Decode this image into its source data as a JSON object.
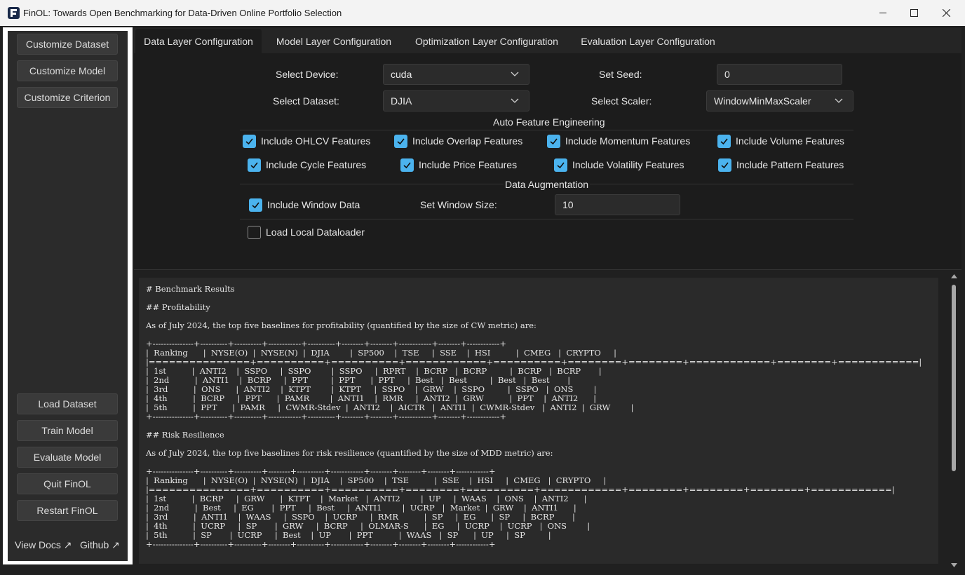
{
  "window": {
    "title": "FinOL: Towards Open Benchmarking for Data-Driven Online Portfolio Selection",
    "icons": {
      "app": "finol-logo-icon",
      "minimize": "minimize-icon",
      "maximize": "maximize-icon",
      "close": "close-icon"
    }
  },
  "sidebar": {
    "top_buttons": [
      "Customize Dataset",
      "Customize Model",
      "Customize Criterion"
    ],
    "bottom_buttons": [
      "Load Dataset",
      "Train Model",
      "Evaluate Model",
      "Quit FinOL",
      "Restart FinOL"
    ],
    "links": [
      "View Docs ↗",
      "Github ↗"
    ]
  },
  "tabs": [
    "Data Layer Configuration",
    "Model Layer Configuration",
    "Optimization Layer Configuration",
    "Evaluation Layer Configuration"
  ],
  "config": {
    "device": {
      "label": "Select Device:",
      "value": "cuda"
    },
    "seed": {
      "label": "Set Seed:",
      "value": "0"
    },
    "dataset": {
      "label": "Select Dataset:",
      "value": "DJIA"
    },
    "scaler": {
      "label": "Select Scaler:",
      "value": "WindowMinMaxScaler"
    },
    "feature_section": "Auto Feature Engineering",
    "features": [
      {
        "label": "Include OHLCV Features",
        "checked": true
      },
      {
        "label": "Include Overlap Features",
        "checked": true
      },
      {
        "label": "Include Momentum Features",
        "checked": true
      },
      {
        "label": "Include Volume Features",
        "checked": true
      },
      {
        "label": "Include Cycle Features",
        "checked": true
      },
      {
        "label": "Include Price Features",
        "checked": true
      },
      {
        "label": "Include Volatility Features",
        "checked": true
      },
      {
        "label": "Include Pattern Features",
        "checked": true
      }
    ],
    "augmentation_section": "Data Augmentation",
    "window_data": {
      "label": "Include Window Data",
      "checked": true
    },
    "window_size": {
      "label": "Set Window Size:",
      "value": "10"
    },
    "local_loader": {
      "label": "Load Local Dataloader",
      "checked": false
    }
  },
  "results": {
    "heading": "# Benchmark Results",
    "profit_heading": "## Profitability",
    "profit_intro": "As of July 2024, the top five baselines for profitability (quantified by the size of CW metric) are:",
    "profit_table": "+---------------+----------+----------+------------+----------+--------+--------+------------+--------+------------+\n|  Ranking      |  NYSE(O)  |  NYSE(N)  |  DJIA        |  SP500    |  TSE     |  SSE    |  HSI          |  CMEG   |  CRYPTO     |\n|===============+==========+==========+============+==========+========+========+============+========+============|\n|  1st          |  ANTI2    |  SSPO     |  SSPO        |  SSPO     |  RPRT    |  BCRP   |  BCRP         |  BCRP   |  BCRP       |\n|  2nd          |  ANTI1    |  BCRP     |  PPT         |  PPT      |  PPT     |  Best   |  Best         |  Best   |  Best       |\n|  3rd          |  ONS      |  ANTI2    |  KTPT        |  KTPT     |  SSPO    |  GRW    |  SSPO         |  SSPO   |  ONS        |\n|  4th          |  BCRP     |  PPT      |  PAMR        |  ANTI1    |  RMR     |  ANTI2  |  GRW          |  PPT    |  ANTI2      |\n|  5th          |  PPT      |  PAMR     |  CWMR-Stdev  |  ANTI2    |  AICTR   |  ANTI1  |  CWMR-Stdev   |  ANTI2  |  GRW        |\n+---------------+----------+----------+------------+----------+--------+--------+------------+--------+------------+",
    "risk_heading": "## Risk Resilience",
    "risk_intro": "As of July 2024, the top five baselines for risk resilience (quantified by the size of MDD metric) are:",
    "risk_table": "+---------------+----------+----------+--------+----------+------------+--------+--------+--------+------------+\n|  Ranking      |  NYSE(O)  |  NYSE(N)  |  DJIA    |  SP500    |  TSE          |  SSE    |  HSI     |  CMEG   |  CRYPTO     |\n|===============+==========+==========+========+==========+============+========+========+========+============|\n|  1st          |  BCRP     |  GRW      |  KTPT    |  Market   |  ANTI2        |  UP     |  WAAS    |  ONS    |  ANTI2      |\n|  2nd          |  Best     |  EG       |  PPT     |  Best     |  ANTI1        |  UCRP   |  Market  |  GRW    |  ANTI1      |\n|  3rd          |  ANTI1    |  WAAS     |  SSPO    |  UCRP     |  RMR          |  SP     |  EG      |  SP     |  BCRP       |\n|  4th          |  UCRP     |  SP       |  GRW     |  BCRP     |  OLMAR-S      |  EG     |  UCRP    |  UCRP   |  ONS        |\n|  5th          |  SP       |  UCRP     |  Best    |  UP       |  PPT          |  WAAS   |  SP      |  UP     |  SP         |\n+---------------+----------+----------+--------+----------+------------+--------+--------+--------+------------+"
  },
  "colors": {
    "accent": "#4bb3ee",
    "panel": "#1c1c1c",
    "sidebar_frame": "#ffffff"
  }
}
